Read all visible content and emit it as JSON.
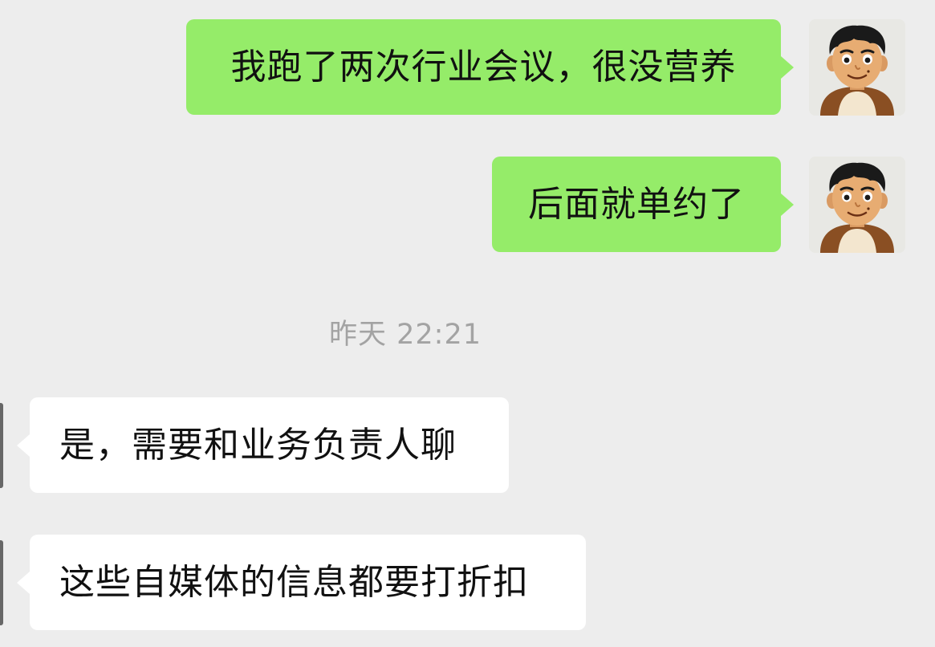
{
  "messages": [
    {
      "direction": "outgoing",
      "text": "我跑了两次行业会议，很没营养"
    },
    {
      "direction": "outgoing",
      "text": "后面就单约了"
    },
    {
      "direction": "incoming",
      "text": "是，需要和业务负责人聊"
    },
    {
      "direction": "incoming",
      "text": "这些自媒体的信息都要打折扣"
    }
  ],
  "timestamp": "昨天 22:21",
  "avatar": {
    "icon": "cartoon-boy-avatar-icon"
  },
  "colors": {
    "background": "#ededed",
    "outgoing_bubble": "#95ec69",
    "incoming_bubble": "#ffffff",
    "timestamp_text": "#a3a3a3",
    "message_text": "#111111"
  }
}
